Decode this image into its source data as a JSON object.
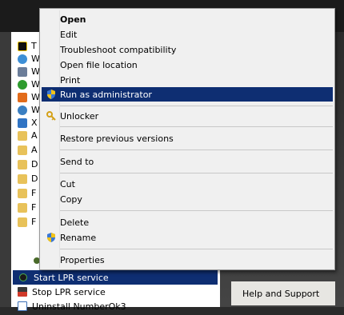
{
  "context_menu": {
    "items": [
      {
        "label": "Open"
      },
      {
        "label": "Edit"
      },
      {
        "label": "Troubleshoot compatibility"
      },
      {
        "label": "Open file location"
      },
      {
        "label": "Print"
      },
      {
        "label": "Run as administrator",
        "icon": "uac-shield-icon"
      },
      {
        "label": "Unlocker",
        "icon": "unlocker-icon"
      },
      {
        "label": "Restore previous versions"
      },
      {
        "label": "Send to"
      },
      {
        "label": "Cut"
      },
      {
        "label": "Copy"
      },
      {
        "label": "Delete"
      },
      {
        "label": "Rename",
        "icon": "uac-shield-icon"
      },
      {
        "label": "Properties"
      }
    ],
    "highlight_color": "#0e2e72"
  },
  "program_list": {
    "letters": [
      "T",
      "W",
      "W",
      "W",
      "W",
      "W",
      "X",
      "A",
      "A",
      "D",
      "D",
      "F",
      "F",
      "F"
    ],
    "bottom_items": [
      {
        "label": "Start LPR service",
        "icon": "service-icon"
      },
      {
        "label": "Stop LPR service",
        "icon": "stop-icon"
      },
      {
        "label": "Uninstall NumberOk3",
        "icon": "uninstall-icon"
      }
    ]
  },
  "right_pane": {
    "help": "Help and Support"
  }
}
